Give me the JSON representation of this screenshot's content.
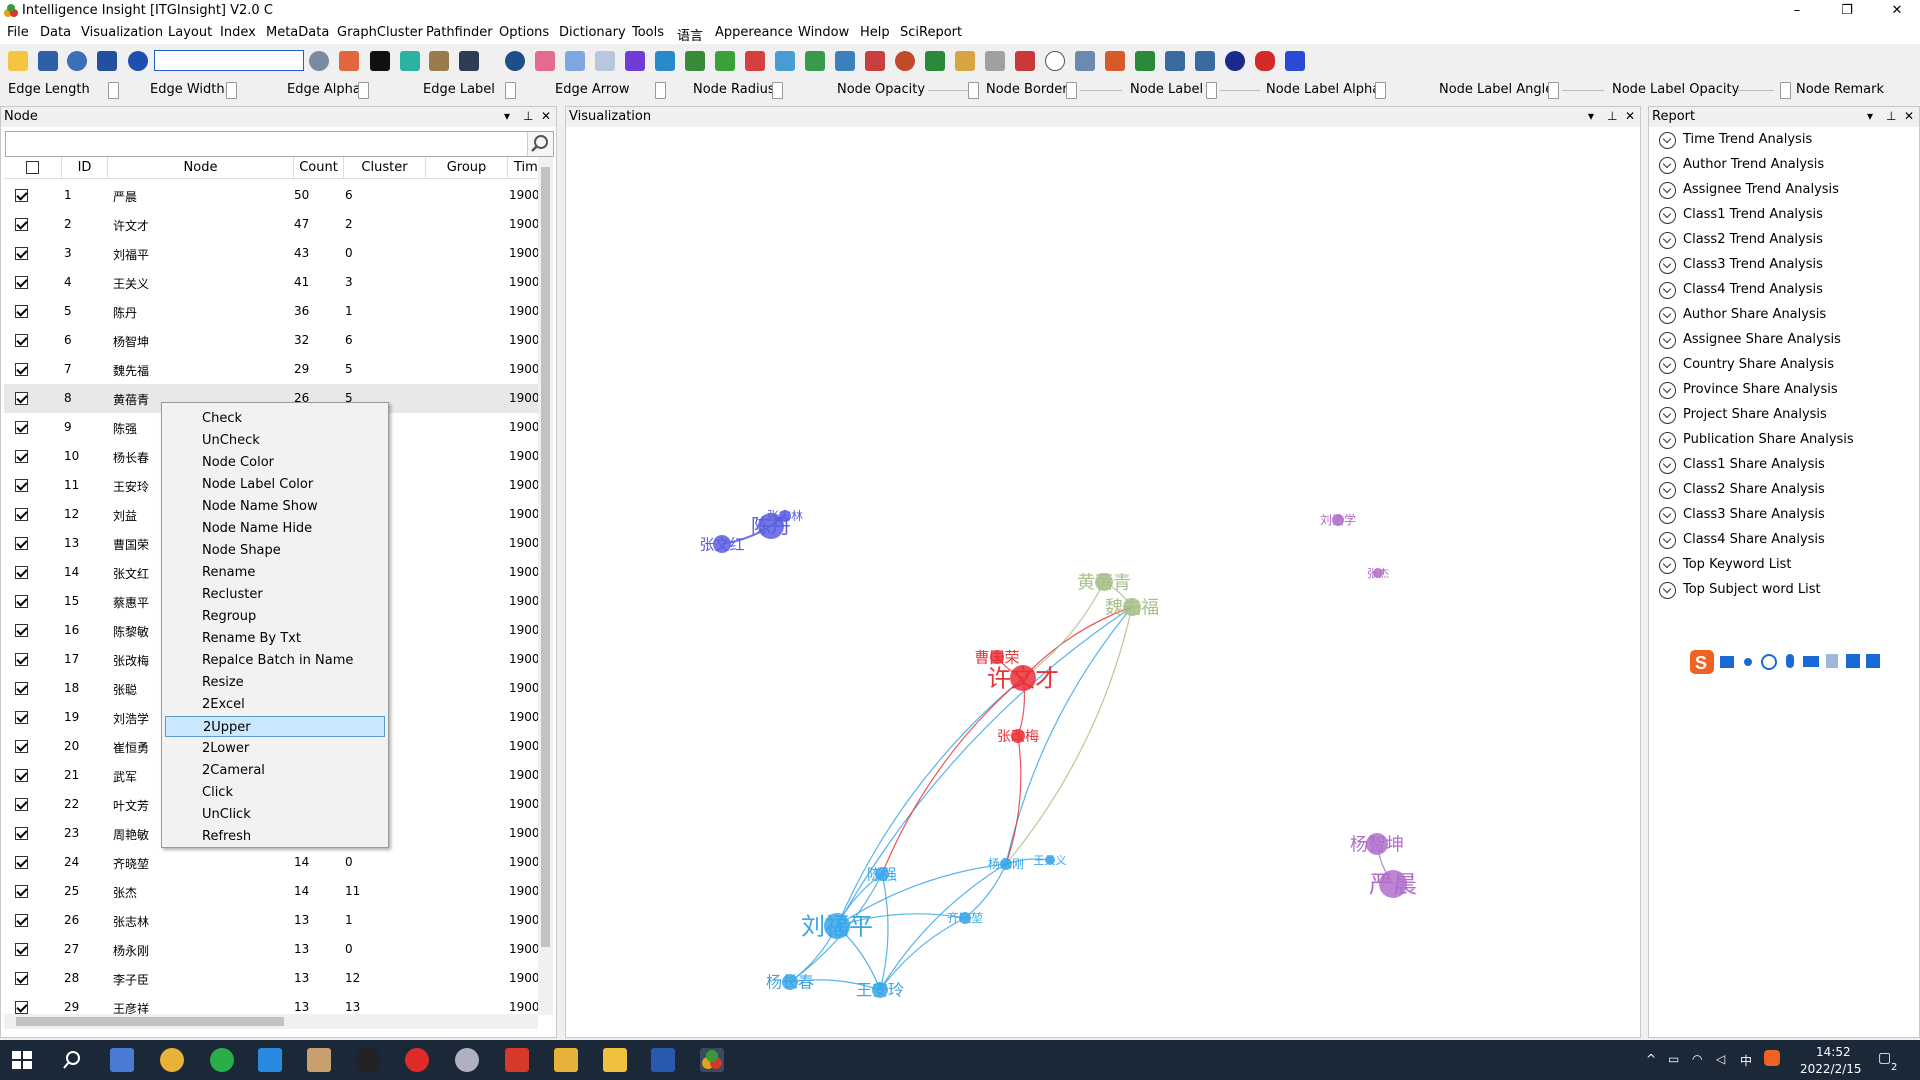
{
  "window": {
    "title": "Intelligence Insight [ITGInsight] V2.0 C",
    "minimize": "–",
    "maximize": "❐",
    "close": "✕"
  },
  "menu": [
    "File",
    "Data",
    "Visualization",
    "Layout",
    "Index",
    "MetaData",
    "GraphCluster",
    "Pathfinder",
    "Options",
    "Dictionary",
    "Tools",
    "语言",
    "Appereance",
    "Window",
    "Help",
    "SciReport"
  ],
  "toolbar": {
    "search_value": ""
  },
  "sliders": [
    "Edge Length",
    "Edge Width",
    "Edge Alpha",
    "Edge Label",
    "Edge Arrow",
    "Node Radius",
    "Node Opacity",
    "Node Border",
    "Node Label",
    "Node Label Alpha",
    "Node Label Angle",
    "Node Label Opacity",
    "Node Remark"
  ],
  "node_panel": {
    "title": "Node",
    "search_value": "",
    "columns": [
      "ID",
      "Node",
      "Count",
      "Cluster",
      "Group",
      "Tim"
    ],
    "rows": [
      {
        "id": "1",
        "node": "严晨",
        "count": "50",
        "cluster": "6",
        "group": "",
        "time": "1900"
      },
      {
        "id": "2",
        "node": "许文才",
        "count": "47",
        "cluster": "2",
        "group": "",
        "time": "1900"
      },
      {
        "id": "3",
        "node": "刘福平",
        "count": "43",
        "cluster": "0",
        "group": "",
        "time": "1900"
      },
      {
        "id": "4",
        "node": "王关义",
        "count": "41",
        "cluster": "3",
        "group": "",
        "time": "1900"
      },
      {
        "id": "5",
        "node": "陈丹",
        "count": "36",
        "cluster": "1",
        "group": "",
        "time": "1900"
      },
      {
        "id": "6",
        "node": "杨智坤",
        "count": "32",
        "cluster": "6",
        "group": "",
        "time": "1900"
      },
      {
        "id": "7",
        "node": "魏先福",
        "count": "29",
        "cluster": "5",
        "group": "",
        "time": "1900"
      },
      {
        "id": "8",
        "node": "黄蓓青",
        "count": "26",
        "cluster": "5",
        "group": "",
        "time": "1900"
      },
      {
        "id": "9",
        "node": "陈强",
        "count": "",
        "cluster": "",
        "group": "",
        "time": "1900"
      },
      {
        "id": "10",
        "node": "杨长春",
        "count": "",
        "cluster": "",
        "group": "",
        "time": "1900"
      },
      {
        "id": "11",
        "node": "王安玲",
        "count": "",
        "cluster": "",
        "group": "",
        "time": "1900"
      },
      {
        "id": "12",
        "node": "刘益",
        "count": "",
        "cluster": "",
        "group": "",
        "time": "1900"
      },
      {
        "id": "13",
        "node": "曹国荣",
        "count": "",
        "cluster": "",
        "group": "",
        "time": "1900"
      },
      {
        "id": "14",
        "node": "张文红",
        "count": "",
        "cluster": "",
        "group": "",
        "time": "1900"
      },
      {
        "id": "15",
        "node": "蔡惠平",
        "count": "",
        "cluster": "",
        "group": "",
        "time": "1900"
      },
      {
        "id": "16",
        "node": "陈黎敏",
        "count": "",
        "cluster": "",
        "group": "",
        "time": "1900"
      },
      {
        "id": "17",
        "node": "张改梅",
        "count": "",
        "cluster": "",
        "group": "",
        "time": "1900"
      },
      {
        "id": "18",
        "node": "张聪",
        "count": "",
        "cluster": "",
        "group": "",
        "time": "1900"
      },
      {
        "id": "19",
        "node": "刘浩学",
        "count": "",
        "cluster": "",
        "group": "",
        "time": "1900"
      },
      {
        "id": "20",
        "node": "崔恒勇",
        "count": "",
        "cluster": "",
        "group": "",
        "time": "1900"
      },
      {
        "id": "21",
        "node": "武军",
        "count": "",
        "cluster": "",
        "group": "",
        "time": "1900"
      },
      {
        "id": "22",
        "node": "叶文芳",
        "count": "",
        "cluster": "",
        "group": "",
        "time": "1900"
      },
      {
        "id": "23",
        "node": "周艳敏",
        "count": "",
        "cluster": "",
        "group": "",
        "time": "1900"
      },
      {
        "id": "24",
        "node": "齐晓堃",
        "count": "14",
        "cluster": "0",
        "group": "",
        "time": "1900"
      },
      {
        "id": "25",
        "node": "张杰",
        "count": "14",
        "cluster": "11",
        "group": "",
        "time": "1900"
      },
      {
        "id": "26",
        "node": "张志林",
        "count": "13",
        "cluster": "1",
        "group": "",
        "time": "1900"
      },
      {
        "id": "27",
        "node": "杨永刚",
        "count": "13",
        "cluster": "0",
        "group": "",
        "time": "1900"
      },
      {
        "id": "28",
        "node": "李子臣",
        "count": "13",
        "cluster": "12",
        "group": "",
        "time": "1900"
      },
      {
        "id": "29",
        "node": "王彦祥",
        "count": "13",
        "cluster": "13",
        "group": "",
        "time": "1900"
      }
    ]
  },
  "context_menu": {
    "items": [
      "Check",
      "UnCheck",
      "Node Color",
      "Node Label Color",
      "Node Name Show",
      "Node Name Hide",
      "Node Shape",
      "Rename",
      "Recluster",
      "Regroup",
      "Rename By Txt",
      "Repalce Batch in Name",
      "Resize",
      "2Excel",
      "2Upper",
      "2Lower",
      "2Cameral",
      "Click",
      "UnClick",
      "Refresh"
    ],
    "highlighted": "2Upper"
  },
  "visualization": {
    "title": "Visualization",
    "nodes": [
      {
        "label": "刘福平",
        "color": "#3aa6e8"
      },
      {
        "label": "许文才",
        "color": "#e8333a"
      },
      {
        "label": "严晨",
        "color": "#b06ec9"
      },
      {
        "label": "杨智坤",
        "color": "#b06ec9"
      },
      {
        "label": "黄蓓青",
        "color": "#a8bf8a"
      },
      {
        "label": "魏先福",
        "color": "#a8bf8a"
      },
      {
        "label": "曹国荣",
        "color": "#e8333a"
      },
      {
        "label": "张改梅",
        "color": "#e8333a"
      },
      {
        "label": "陈强",
        "color": "#3aa6e8"
      },
      {
        "label": "杨长春",
        "color": "#3aa6e8"
      },
      {
        "label": "王安玲",
        "color": "#3aa6e8"
      },
      {
        "label": "杨永刚",
        "color": "#3aa6e8"
      },
      {
        "label": "齐晓堃",
        "color": "#3aa6e8"
      },
      {
        "label": "陈丹",
        "color": "#5b5ee0"
      },
      {
        "label": "张志林",
        "color": "#5b5ee0"
      },
      {
        "label": "张文红",
        "color": "#5b5ee0"
      },
      {
        "label": "刘浩学",
        "color": "#b06ec9"
      },
      {
        "label": "张杰",
        "color": "#b06ec9"
      },
      {
        "label": "王关义",
        "color": "#3aa6e8"
      }
    ]
  },
  "report": {
    "title": "Report",
    "items": [
      "Time Trend Analysis",
      "Author Trend Analysis",
      "Assignee Trend Analysis",
      "Class1 Trend Analysis",
      "Class2 Trend Analysis",
      "Class3 Trend Analysis",
      "Class4 Trend Analysis",
      "Author Share Analysis",
      "Assignee Share Analysis",
      "Country Share Analysis",
      "Province Share Analysis",
      "Project Share Analysis",
      "Publication Share Analysis",
      "Class1 Share Analysis",
      "Class2 Share Analysis",
      "Class3 Share Analysis",
      "Class4 Share Analysis",
      "Top Keyword List",
      "Top Subject word List"
    ]
  },
  "taskbar": {
    "time": "14:52",
    "date": "2022/2/15",
    "ime": "中",
    "notification_count": "2"
  }
}
